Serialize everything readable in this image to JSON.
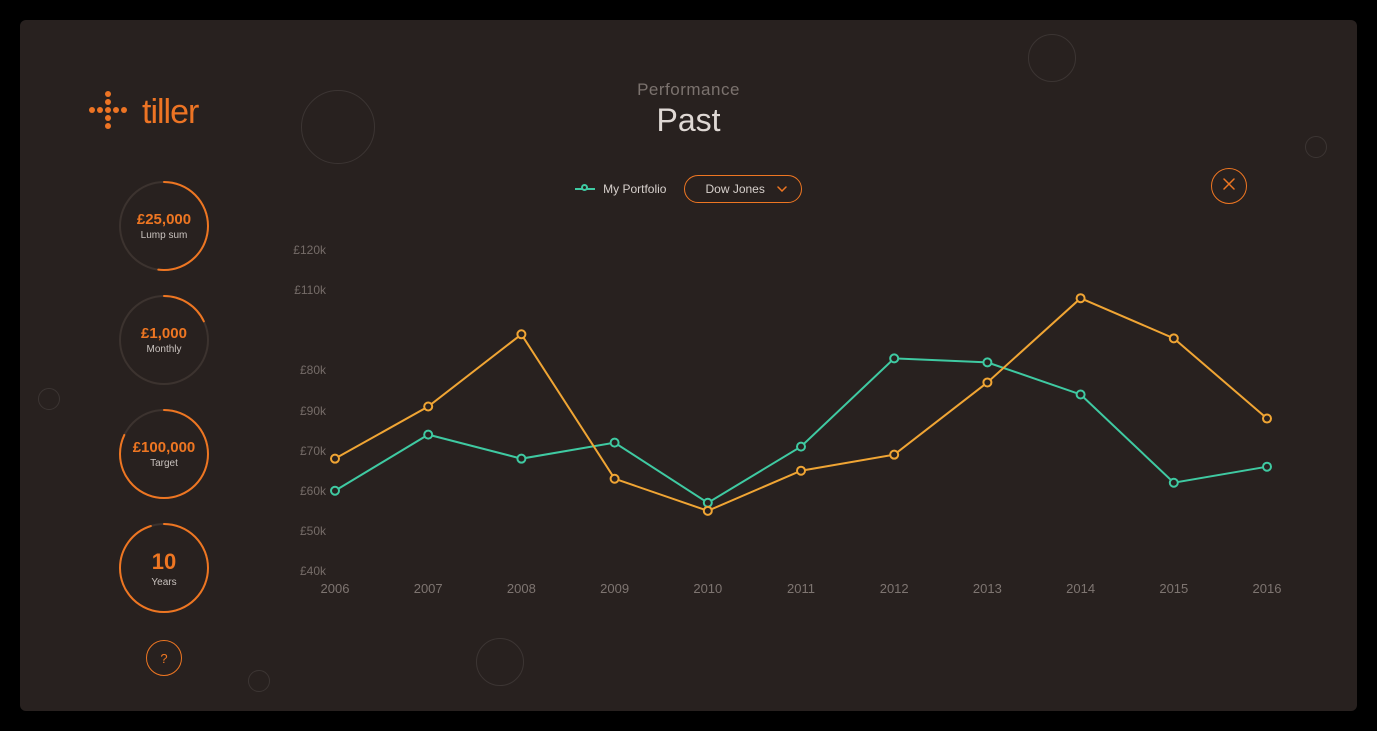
{
  "brand": {
    "name": "tiller"
  },
  "header": {
    "small": "Performance",
    "big": "Past"
  },
  "sidebar": {
    "items": [
      {
        "value": "£25,000",
        "label": "Lump sum",
        "progress": 0.52
      },
      {
        "value": "£1,000",
        "label": "Monthly",
        "progress": 0.18
      },
      {
        "value": "£100,000",
        "label": "Target",
        "progress": 0.82
      },
      {
        "value": "10",
        "label": "Years",
        "progress": 0.95
      }
    ],
    "help_label": "?"
  },
  "legend": {
    "portfolio_label": "My Portfolio",
    "benchmark_label": "Dow Jones"
  },
  "colors": {
    "portfolio": "#3fcaa2",
    "benchmark": "#f0a534",
    "accent": "#ee7622"
  },
  "chart_data": {
    "type": "line",
    "title": "Performance — Past",
    "xlabel": "",
    "ylabel": "",
    "x": [
      2006,
      2007,
      2008,
      2009,
      2010,
      2011,
      2012,
      2013,
      2014,
      2015,
      2016
    ],
    "ytick_labels": [
      "£40k",
      "£50k",
      "£60k",
      "£70k",
      "£90k",
      "£80k",
      "£110k",
      "£120k"
    ],
    "yticks": [
      40,
      50,
      60,
      70,
      80,
      90,
      110,
      120
    ],
    "ylim": [
      40,
      125
    ],
    "series": [
      {
        "name": "My Portfolio",
        "color": "#3fcaa2",
        "values": [
          60,
          74,
          68,
          72,
          57,
          71,
          93,
          92,
          84,
          62,
          66
        ]
      },
      {
        "name": "Dow Jones",
        "color": "#f0a534",
        "values": [
          68,
          81,
          99,
          63,
          55,
          65,
          69,
          87,
          108,
          98,
          78
        ]
      }
    ]
  }
}
